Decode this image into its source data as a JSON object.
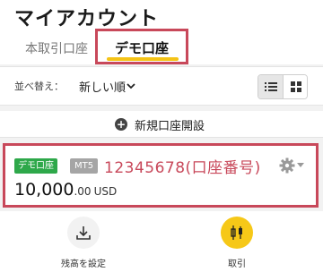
{
  "header": {
    "title": "マイアカウント"
  },
  "tabs": {
    "real_label": "本取引口座",
    "demo_label": "デモ口座"
  },
  "sort": {
    "label": "並べ替え：",
    "value": "新しい順"
  },
  "new_account": {
    "label": "新規口座開設"
  },
  "account": {
    "type_badge": "デモ口座",
    "platform_badge": "MT5",
    "number": "12345678(口座番号)",
    "balance_int": "10,000",
    "balance_dec": ".00",
    "currency": "USD"
  },
  "actions": {
    "set_balance_label": "残高を設定",
    "trade_label": "取引"
  },
  "colors": {
    "highlight": "#c8485a",
    "accent": "#f4c316",
    "demo_badge": "#2ea84a"
  },
  "icons": [
    "chevron-down-icon",
    "list-view-icon",
    "grid-view-icon",
    "plus-circle-icon",
    "gear-icon",
    "download-icon",
    "candlestick-icon"
  ]
}
